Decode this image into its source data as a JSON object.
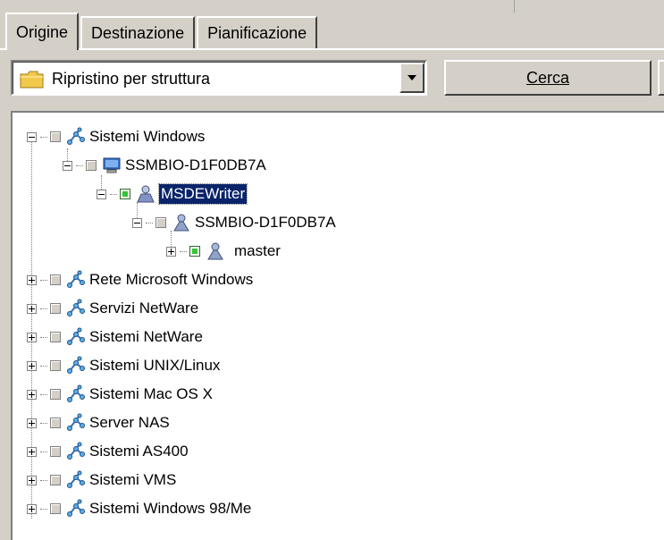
{
  "tabs": [
    {
      "label": "Origine",
      "active": true
    },
    {
      "label": "Destinazione",
      "active": false
    },
    {
      "label": "Pianificazione",
      "active": false
    }
  ],
  "view_selector": {
    "selected": "Ripristino per struttura",
    "icon": "folder-icon"
  },
  "search_button": {
    "label": "Cerca"
  },
  "tree": {
    "root1": {
      "label": "Sistemi Windows",
      "icon": "network-icon"
    },
    "computer": {
      "label": "SSMBIO-D1F0DB7A",
      "icon": "computer-icon"
    },
    "writer": {
      "label": "MSDEWriter",
      "icon": "sql-writer-icon"
    },
    "instance": {
      "label": "SSMBIO-D1F0DB7A",
      "icon": "database-server-icon"
    },
    "database": {
      "label": "master",
      "icon": "database-icon"
    },
    "roots": [
      "Rete Microsoft Windows",
      "Servizi NetWare",
      "Sistemi NetWare",
      "Sistemi UNIX/Linux",
      "Sistemi Mac OS X",
      "Server NAS",
      "Sistemi AS400",
      "Sistemi VMS",
      "Sistemi Windows 98/Me"
    ]
  },
  "colors": {
    "selection": "#0a246a",
    "checked": "#34c434",
    "face": "#d4d0c8"
  }
}
